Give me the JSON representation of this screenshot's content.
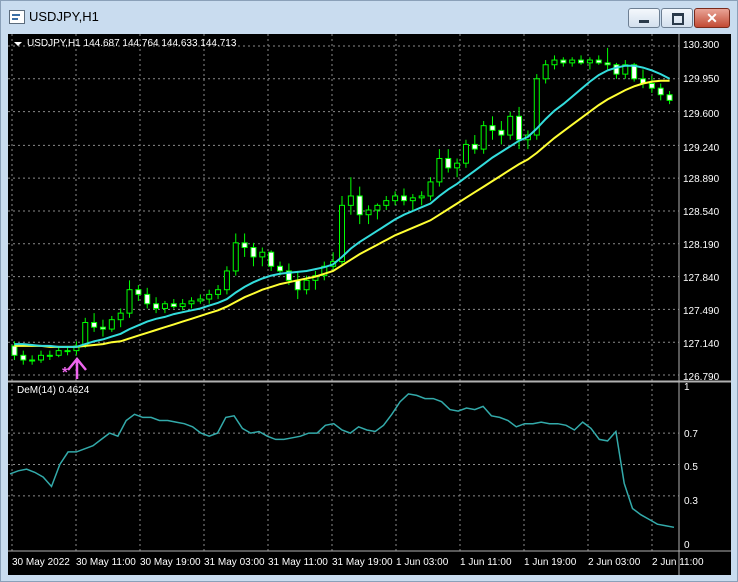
{
  "window": {
    "title": "USDJPY,H1",
    "buttons": {
      "minimize": "minimize",
      "maximize": "maximize",
      "close": "✕"
    }
  },
  "main_chart": {
    "info_label": "USDJPY,H1  144.687 144.764 144.633 144.713",
    "price_labels": [
      "130.300",
      "129.950",
      "129.600",
      "129.240",
      "128.890",
      "128.540",
      "128.190",
      "127.840",
      "127.490",
      "127.140",
      "126.790"
    ]
  },
  "indicator": {
    "label": "DeM(14) 0.4624",
    "scale_labels": [
      "1",
      "0.7",
      "0.5",
      "0.3",
      "0"
    ]
  },
  "time_labels": [
    "30 May 2022",
    "30 May 11:00",
    "30 May 19:00",
    "31 May 03:00",
    "31 May 11:00",
    "31 May 19:00",
    "1 Jun 03:00",
    "1 Jun 11:00",
    "1 Jun 19:00",
    "2 Jun 03:00",
    "2 Jun 11:00"
  ],
  "colors": {
    "chart_bg": "#000000",
    "candle": "#00ff00",
    "ma_fast": "#33dddd",
    "ma_slow": "#ffff33",
    "dem_line": "#33aaaa",
    "grid": "#8a8a8a",
    "arrow": "#ee66ee"
  },
  "chart_data": [
    {
      "type": "candlestick",
      "symbol": "USDJPY",
      "timeframe": "H1",
      "ylim": [
        126.79,
        130.3
      ],
      "grid": true,
      "ohlc": [
        [
          127.1,
          127.15,
          126.95,
          127.0
        ],
        [
          127.0,
          127.05,
          126.9,
          126.95
        ],
        [
          126.95,
          127.0,
          126.9,
          126.95
        ],
        [
          126.95,
          127.05,
          126.92,
          127.0
        ],
        [
          127.0,
          127.05,
          126.95,
          127.0
        ],
        [
          127.0,
          127.1,
          126.98,
          127.05
        ],
        [
          127.05,
          127.1,
          127.0,
          127.05
        ],
        [
          127.05,
          127.15,
          127.0,
          127.1
        ],
        [
          127.1,
          127.4,
          127.08,
          127.35
        ],
        [
          127.35,
          127.45,
          127.25,
          127.3
        ],
        [
          127.3,
          127.38,
          127.2,
          127.28
        ],
        [
          127.28,
          127.42,
          127.25,
          127.38
        ],
        [
          127.38,
          127.5,
          127.3,
          127.45
        ],
        [
          127.45,
          127.8,
          127.4,
          127.7
        ],
        [
          127.7,
          127.75,
          127.58,
          127.65
        ],
        [
          127.65,
          127.72,
          127.5,
          127.55
        ],
        [
          127.55,
          127.62,
          127.45,
          127.5
        ],
        [
          127.5,
          127.58,
          127.45,
          127.55
        ],
        [
          127.55,
          127.6,
          127.5,
          127.52
        ],
        [
          127.52,
          127.6,
          127.48,
          127.55
        ],
        [
          127.55,
          127.62,
          127.5,
          127.58
        ],
        [
          127.58,
          127.65,
          127.55,
          127.6
        ],
        [
          127.6,
          127.7,
          127.55,
          127.65
        ],
        [
          127.65,
          127.75,
          127.6,
          127.7
        ],
        [
          127.7,
          127.95,
          127.65,
          127.9
        ],
        [
          127.9,
          128.3,
          127.85,
          128.2
        ],
        [
          128.2,
          128.3,
          128.05,
          128.15
        ],
        [
          128.15,
          128.2,
          127.95,
          128.05
        ],
        [
          128.05,
          128.15,
          127.95,
          128.1
        ],
        [
          128.1,
          128.12,
          127.9,
          127.95
        ],
        [
          127.95,
          128.0,
          127.85,
          127.9
        ],
        [
          127.9,
          127.98,
          127.75,
          127.8
        ],
        [
          127.8,
          127.9,
          127.6,
          127.7
        ],
        [
          127.7,
          127.85,
          127.65,
          127.8
        ],
        [
          127.8,
          127.9,
          127.7,
          127.85
        ],
        [
          127.85,
          128.0,
          127.8,
          127.95
        ],
        [
          127.95,
          128.1,
          127.9,
          128.0
        ],
        [
          128.0,
          128.7,
          127.95,
          128.6
        ],
        [
          128.6,
          128.9,
          128.5,
          128.7
        ],
        [
          128.7,
          128.8,
          128.4,
          128.5
        ],
        [
          128.5,
          128.6,
          128.4,
          128.55
        ],
        [
          128.55,
          128.62,
          128.45,
          128.6
        ],
        [
          128.6,
          128.7,
          128.55,
          128.65
        ],
        [
          128.65,
          128.75,
          128.6,
          128.7
        ],
        [
          128.7,
          128.78,
          128.6,
          128.65
        ],
        [
          128.65,
          128.72,
          128.55,
          128.68
        ],
        [
          128.68,
          128.75,
          128.6,
          128.7
        ],
        [
          128.7,
          128.9,
          128.65,
          128.85
        ],
        [
          128.85,
          129.2,
          128.8,
          129.1
        ],
        [
          129.1,
          129.2,
          128.95,
          129.0
        ],
        [
          129.0,
          129.1,
          128.9,
          129.05
        ],
        [
          129.05,
          129.3,
          129.0,
          129.25
        ],
        [
          129.25,
          129.35,
          129.15,
          129.2
        ],
        [
          129.2,
          129.5,
          129.15,
          129.45
        ],
        [
          129.45,
          129.55,
          129.3,
          129.4
        ],
        [
          129.4,
          129.5,
          129.25,
          129.35
        ],
        [
          129.35,
          129.6,
          129.3,
          129.55
        ],
        [
          129.55,
          129.65,
          129.2,
          129.3
        ],
        [
          129.3,
          129.4,
          129.2,
          129.35
        ],
        [
          129.35,
          130.0,
          129.3,
          129.95
        ],
        [
          129.95,
          130.15,
          129.9,
          130.1
        ],
        [
          130.1,
          130.2,
          130.05,
          130.15
        ],
        [
          130.15,
          130.18,
          130.08,
          130.12
        ],
        [
          130.12,
          130.18,
          130.08,
          130.15
        ],
        [
          130.15,
          130.2,
          130.1,
          130.12
        ],
        [
          130.12,
          130.18,
          130.05,
          130.15
        ],
        [
          130.15,
          130.2,
          130.1,
          130.12
        ],
        [
          130.12,
          130.28,
          130.05,
          130.1
        ],
        [
          130.1,
          130.12,
          129.95,
          130.0
        ],
        [
          130.0,
          130.15,
          129.95,
          130.1
        ],
        [
          130.1,
          130.12,
          129.92,
          129.95
        ],
        [
          129.95,
          130.05,
          129.85,
          129.9
        ],
        [
          129.9,
          129.98,
          129.8,
          129.85
        ],
        [
          129.85,
          129.9,
          129.72,
          129.78
        ],
        [
          129.78,
          129.82,
          129.68,
          129.72
        ]
      ],
      "ma_fast": [
        127.12,
        127.12,
        127.11,
        127.1,
        127.1,
        127.09,
        127.09,
        127.09,
        127.12,
        127.15,
        127.17,
        127.2,
        127.23,
        127.28,
        127.32,
        127.36,
        127.39,
        127.41,
        127.44,
        127.46,
        127.48,
        127.5,
        127.53,
        127.56,
        127.6,
        127.67,
        127.73,
        127.78,
        127.82,
        127.85,
        127.87,
        127.88,
        127.89,
        127.9,
        127.92,
        127.94,
        127.97,
        128.05,
        128.14,
        128.21,
        128.27,
        128.33,
        128.39,
        128.45,
        128.5,
        128.54,
        128.58,
        128.62,
        128.7,
        128.77,
        128.83,
        128.9,
        128.97,
        129.04,
        129.11,
        129.17,
        129.23,
        129.29,
        129.33,
        129.42,
        129.52,
        129.61,
        129.68,
        129.76,
        129.84,
        129.92,
        129.99,
        130.04,
        130.07,
        130.09,
        130.09,
        130.07,
        130.04,
        130.0,
        129.95
      ],
      "ma_slow": [
        127.1,
        127.1,
        127.1,
        127.1,
        127.09,
        127.09,
        127.09,
        127.09,
        127.1,
        127.11,
        127.12,
        127.14,
        127.15,
        127.18,
        127.21,
        127.24,
        127.27,
        127.3,
        127.33,
        127.36,
        127.39,
        127.42,
        127.45,
        127.48,
        127.52,
        127.57,
        127.62,
        127.66,
        127.7,
        127.73,
        127.76,
        127.78,
        127.8,
        127.82,
        127.84,
        127.87,
        127.9,
        127.96,
        128.02,
        128.08,
        128.13,
        128.18,
        128.23,
        128.28,
        128.32,
        128.36,
        128.4,
        128.44,
        128.5,
        128.56,
        128.62,
        128.68,
        128.74,
        128.8,
        128.86,
        128.92,
        128.98,
        129.04,
        129.09,
        129.16,
        129.24,
        129.32,
        129.39,
        129.46,
        129.53,
        129.6,
        129.67,
        129.73,
        129.78,
        129.83,
        129.87,
        129.9,
        129.92,
        129.93,
        129.93
      ]
    },
    {
      "type": "line",
      "name": "DeM(14)",
      "ylim": [
        0,
        1
      ],
      "values": [
        0.44,
        0.46,
        0.47,
        0.45,
        0.42,
        0.36,
        0.5,
        0.58,
        0.58,
        0.6,
        0.62,
        0.66,
        0.7,
        0.68,
        0.78,
        0.82,
        0.8,
        0.8,
        0.78,
        0.78,
        0.77,
        0.76,
        0.74,
        0.7,
        0.68,
        0.7,
        0.8,
        0.81,
        0.73,
        0.7,
        0.71,
        0.68,
        0.66,
        0.66,
        0.67,
        0.68,
        0.7,
        0.7,
        0.75,
        0.76,
        0.72,
        0.7,
        0.74,
        0.72,
        0.71,
        0.75,
        0.82,
        0.9,
        0.95,
        0.94,
        0.92,
        0.92,
        0.9,
        0.85,
        0.84,
        0.86,
        0.85,
        0.87,
        0.81,
        0.8,
        0.78,
        0.74,
        0.76,
        0.76,
        0.77,
        0.76,
        0.76,
        0.75,
        0.72,
        0.77,
        0.73,
        0.66,
        0.65,
        0.71,
        0.38,
        0.22,
        0.18,
        0.15,
        0.12,
        0.11,
        0.1
      ]
    }
  ]
}
